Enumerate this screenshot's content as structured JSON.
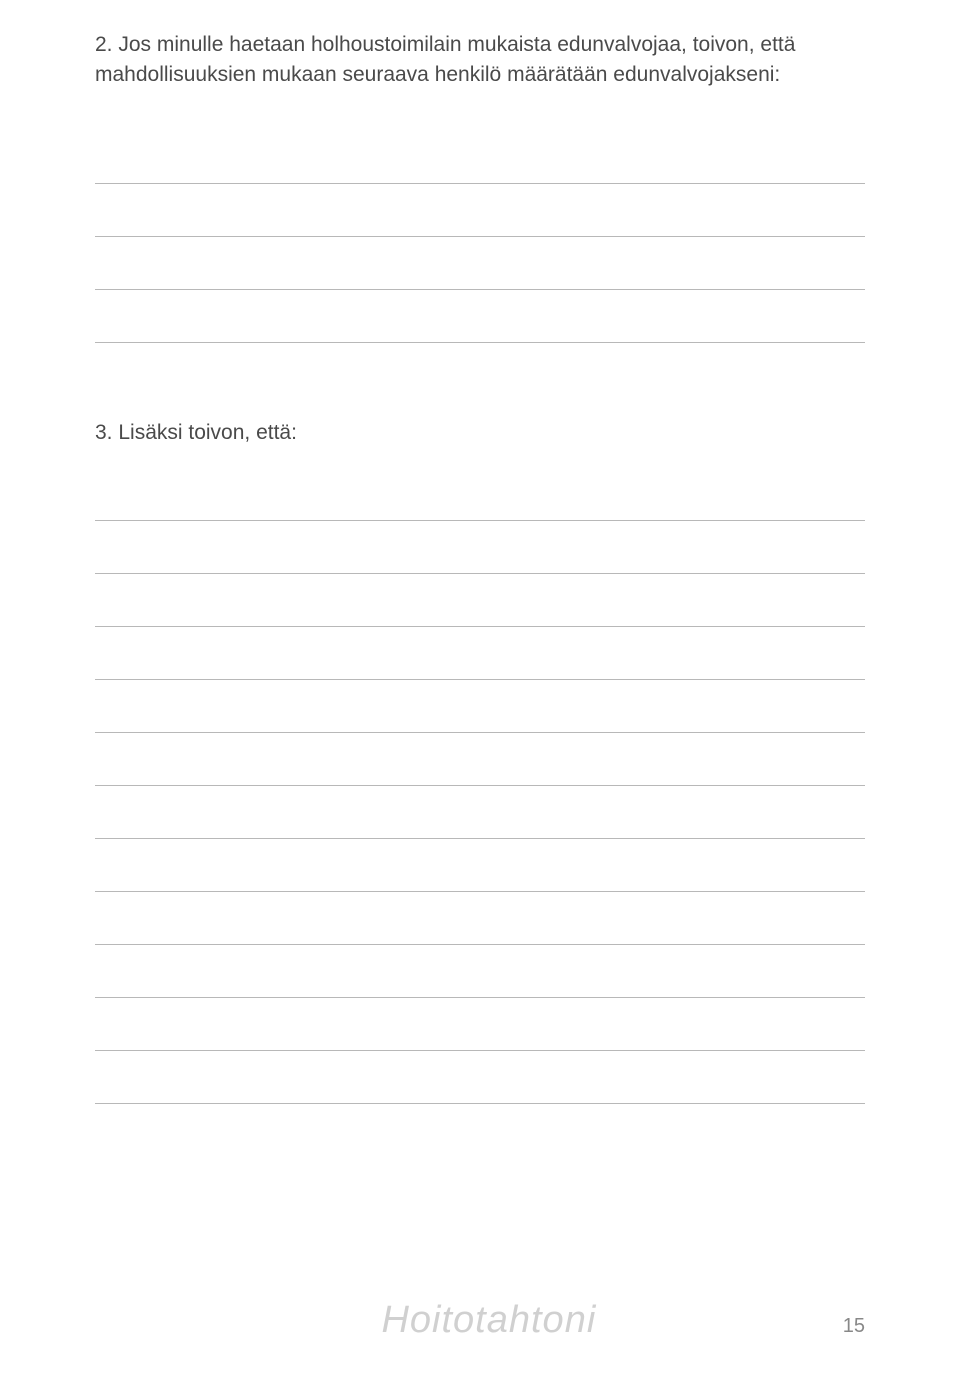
{
  "section2": {
    "text": "2. Jos minulle haetaan holhoustoimilain mukaista edunvalvojaa, toivon, että mahdollisuuksien mukaan seuraava henkilö määrätään edunvalvojakseni:",
    "lineCount": 4
  },
  "section3": {
    "text": "3. Lisäksi toivon, että:",
    "lineCount": 12
  },
  "footer": {
    "title": "Hoitotahtoni",
    "pageNumber": "15"
  }
}
